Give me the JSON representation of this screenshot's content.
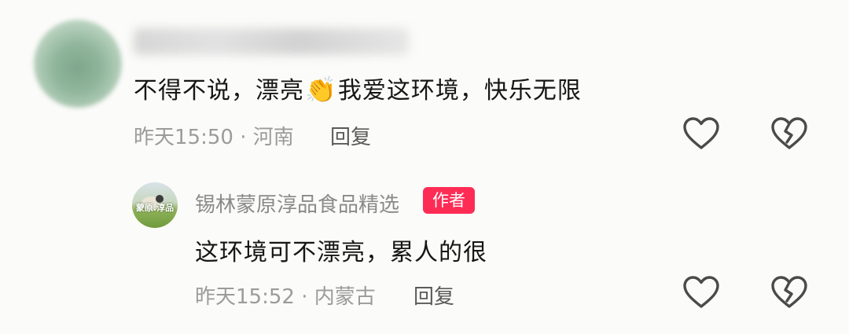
{
  "comment": {
    "text_before": "不得不说，漂亮",
    "emoji": "👏",
    "text_after": "我爱这环境，快乐无限",
    "time": "昨天15:50",
    "separator": " · ",
    "location": "河南",
    "reply_label": "回复",
    "icons": {
      "like": "heart-outline-icon",
      "dislike": "broken-heart-icon"
    }
  },
  "reply": {
    "author": "锡林蒙原淳品食品精选",
    "avatar_text": "蒙原.淳品",
    "badge": "作者",
    "badge_color": "#fe2c55",
    "text": "这环境可不漂亮，累人的很",
    "time": "昨天15:52",
    "separator": " · ",
    "location": "内蒙古",
    "reply_label": "回复",
    "icons": {
      "like": "heart-outline-icon",
      "dislike": "broken-heart-icon"
    }
  }
}
